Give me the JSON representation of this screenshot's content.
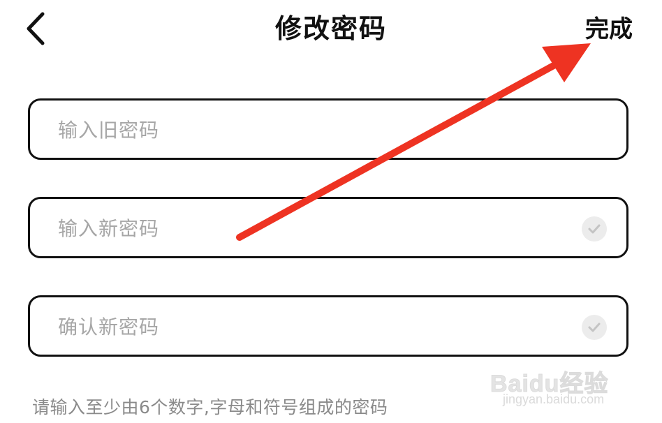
{
  "header": {
    "title": "修改密码",
    "done_label": "完成",
    "back_icon": "chevron-left-icon"
  },
  "form": {
    "old_password": {
      "value": "",
      "placeholder": "输入旧密码"
    },
    "new_password": {
      "value": "",
      "placeholder": "输入新密码",
      "status_icon": "check-circle-icon"
    },
    "confirm_password": {
      "value": "",
      "placeholder": "确认新密码",
      "status_icon": "check-circle-icon"
    },
    "hint": "请输入至少由6个数字,字母和符号组成的密码"
  },
  "annotation": {
    "type": "arrow",
    "color": "#ee3322",
    "points_to": "done-button"
  },
  "watermark": {
    "main": "Baidu经验",
    "sub": "jingyan.baidu.com"
  },
  "colors": {
    "text": "#111111",
    "placeholder": "#a6a6a6",
    "hint": "#8a8a8a",
    "check_bg": "#ececec",
    "arrow": "#ee3322"
  }
}
